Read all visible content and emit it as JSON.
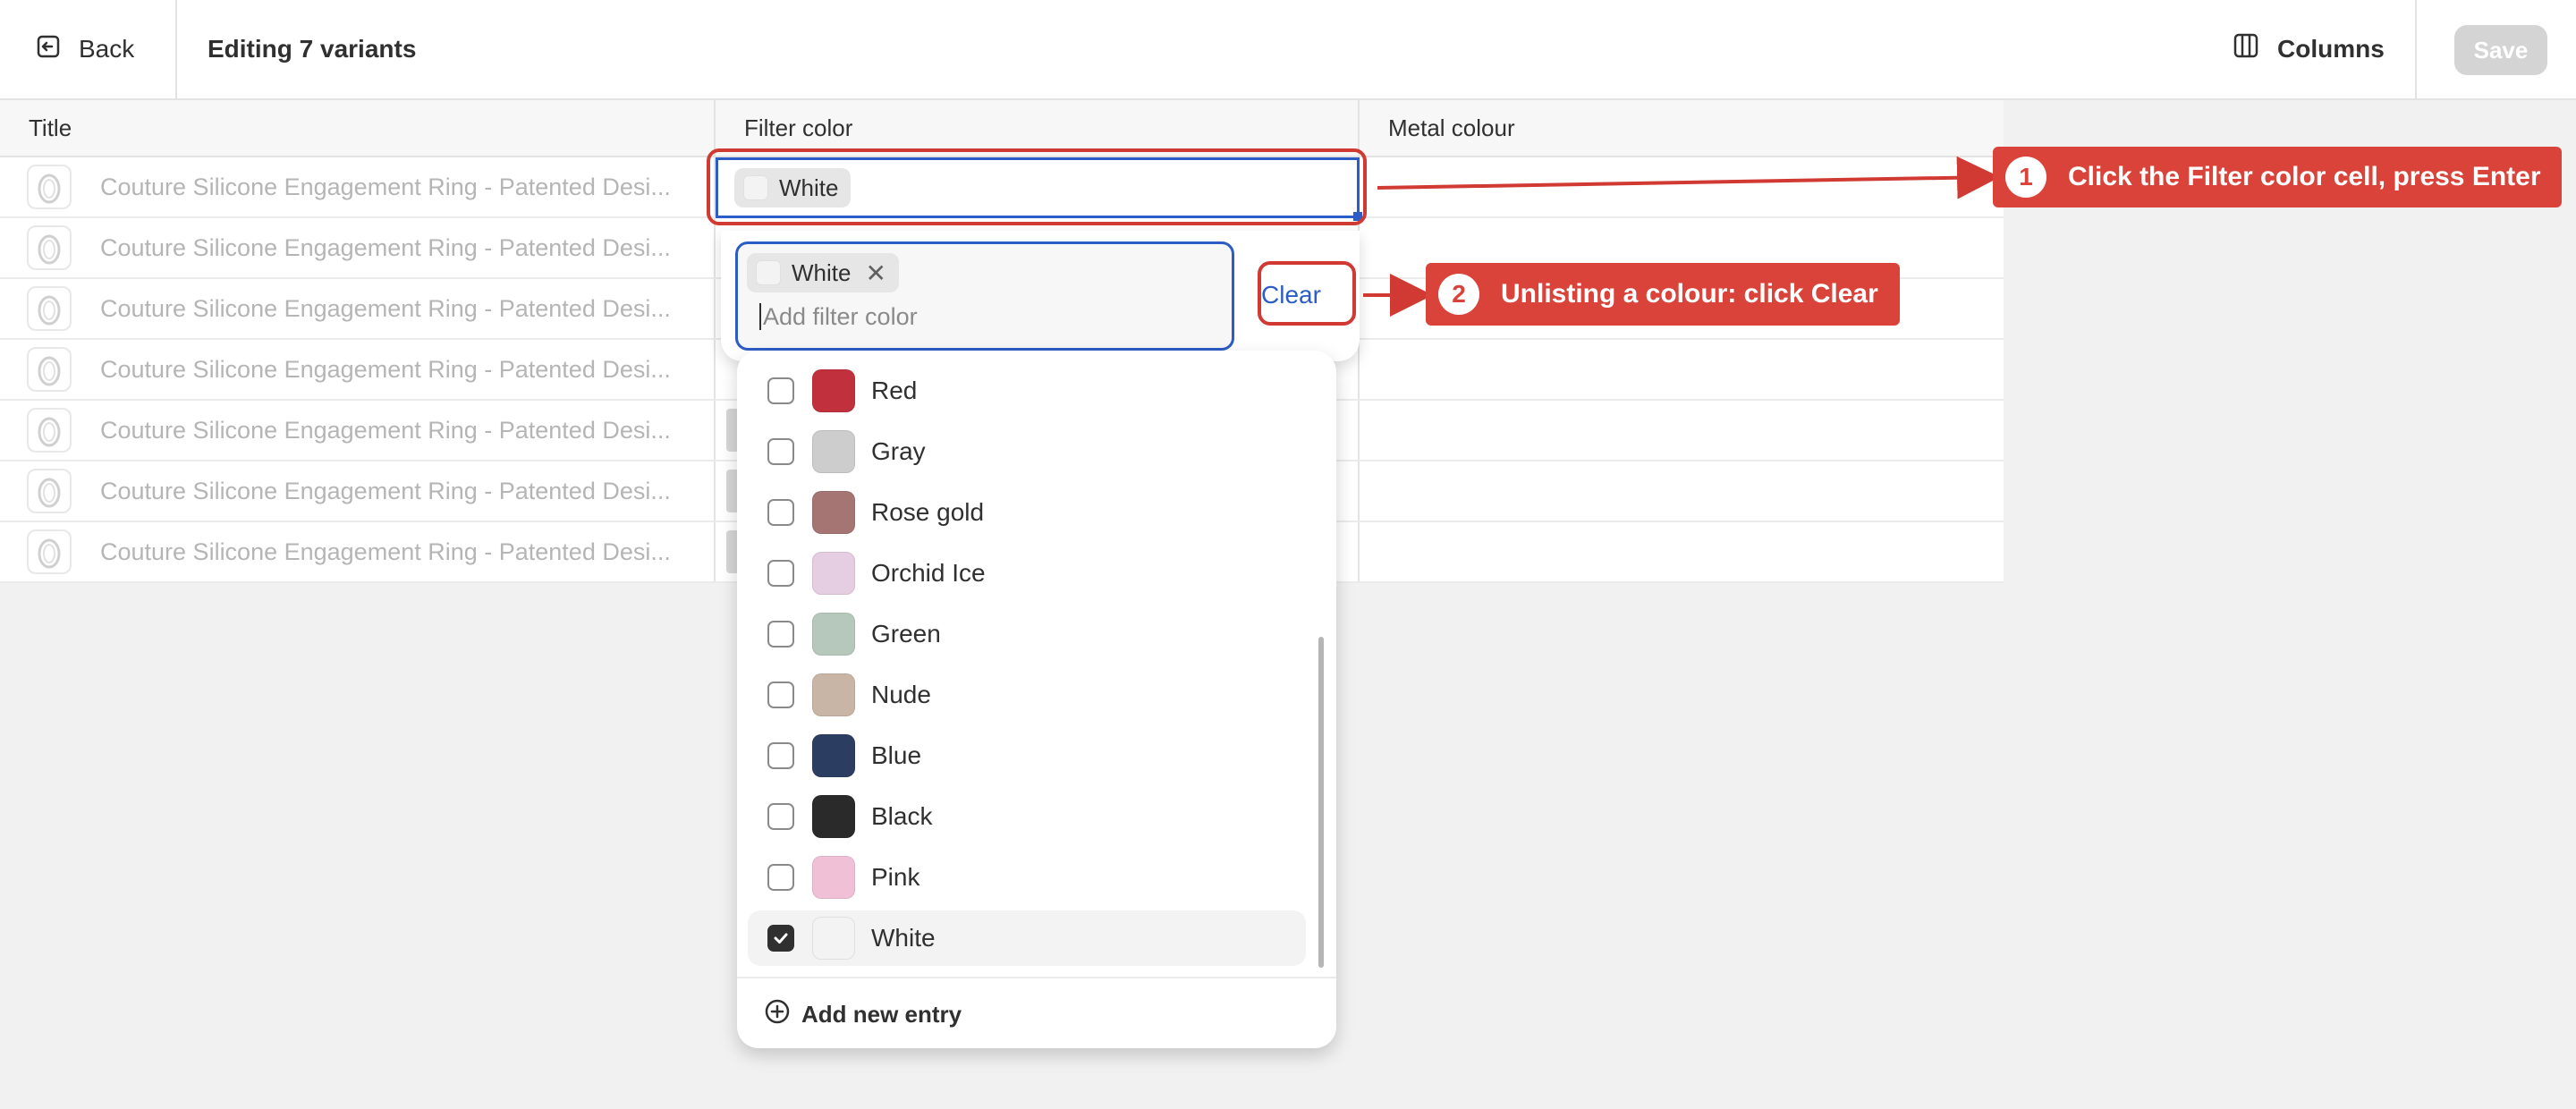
{
  "header": {
    "back_label": "Back",
    "title": "Editing 7 variants",
    "columns_label": "Columns",
    "save_label": "Save"
  },
  "table": {
    "columns": [
      "Title",
      "Filter color",
      "Metal colour"
    ],
    "rows": [
      {
        "title": "Couture Silicone Engagement Ring - Patented Desi..."
      },
      {
        "title": "Couture Silicone Engagement Ring - Patented Desi..."
      },
      {
        "title": "Couture Silicone Engagement Ring - Patented Desi..."
      },
      {
        "title": "Couture Silicone Engagement Ring - Patented Desi..."
      },
      {
        "title": "Couture Silicone Engagement Ring - Patented Desi..."
      },
      {
        "title": "Couture Silicone Engagement Ring - Patented Desi..."
      },
      {
        "title": "Couture Silicone Engagement Ring - Patented Desi..."
      }
    ],
    "active_cell_value": "White"
  },
  "editor": {
    "selected_tag": "White",
    "input_placeholder": "Add filter color",
    "clear_label": "Clear"
  },
  "dropdown": {
    "options": [
      {
        "label": "Red",
        "color": "#c0313d",
        "checked": false
      },
      {
        "label": "Gray",
        "color": "#cdcdcd",
        "checked": false
      },
      {
        "label": "Rose gold",
        "color": "#a57574",
        "checked": false
      },
      {
        "label": "Orchid Ice",
        "color": "#e5cde2",
        "checked": false
      },
      {
        "label": "Green",
        "color": "#b6c8bb",
        "checked": false
      },
      {
        "label": "Nude",
        "color": "#c9b5a5",
        "checked": false
      },
      {
        "label": "Blue",
        "color": "#2c3d62",
        "checked": false
      },
      {
        "label": "Black",
        "color": "#2a2a2a",
        "checked": false
      },
      {
        "label": "Pink",
        "color": "#f0c0d6",
        "checked": false
      },
      {
        "label": "White",
        "color": "#f3f3f3",
        "checked": true
      }
    ],
    "add_entry_label": "Add new entry"
  },
  "annotations": [
    {
      "number": "1",
      "text": "Click the Filter color cell, press Enter"
    },
    {
      "number": "2",
      "text": "Unlisting a colour: click Clear"
    }
  ],
  "colors": {
    "accent_blue": "#2c5cc5",
    "annotation_red": "#d9433a"
  }
}
